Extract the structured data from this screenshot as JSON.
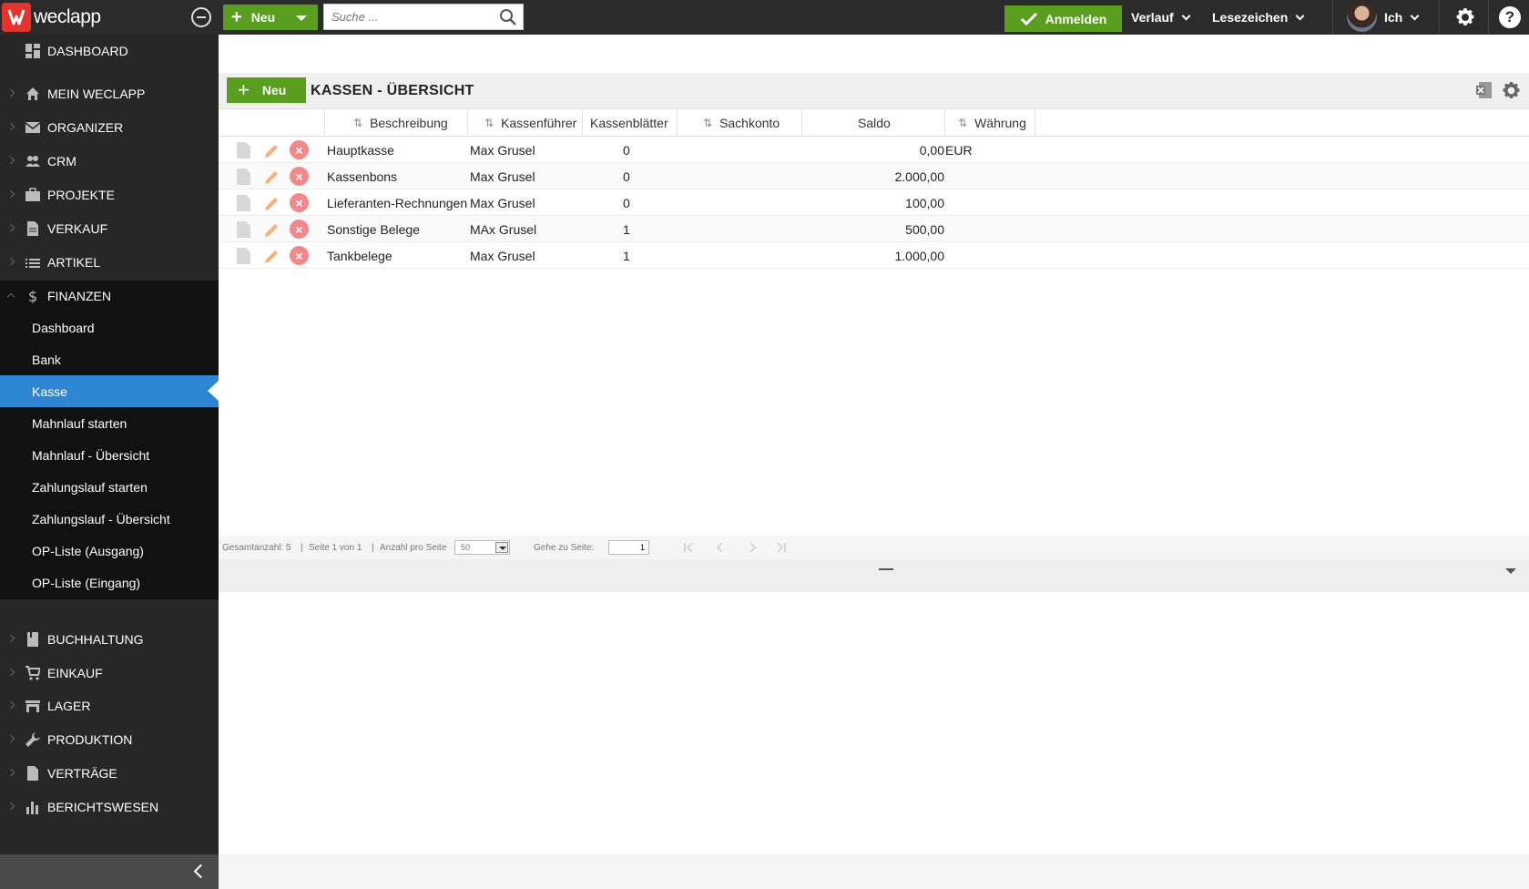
{
  "app": {
    "logo_text": "weclapp"
  },
  "topbar": {
    "new_label": "Neu",
    "search_placeholder": "Suche ...",
    "anmelden_label": "Anmelden",
    "verlauf_label": "Verlauf",
    "lesezeichen_label": "Lesezeichen",
    "user_label": "Ich",
    "help_label": "?"
  },
  "sidebar": {
    "items": [
      {
        "label": "DASHBOARD",
        "icon": "dashboard-icon"
      },
      {
        "label": "MEIN WECLAPP",
        "icon": "home-icon"
      },
      {
        "label": "ORGANIZER",
        "icon": "mail-icon"
      },
      {
        "label": "CRM",
        "icon": "people-icon"
      },
      {
        "label": "PROJEKTE",
        "icon": "briefcase-icon"
      },
      {
        "label": "VERKAUF",
        "icon": "document-icon"
      },
      {
        "label": "ARTIKEL",
        "icon": "list-icon"
      },
      {
        "label": "FINANZEN",
        "icon": "dollar-icon"
      }
    ],
    "finanzen_sub": [
      "Dashboard",
      "Bank",
      "Kasse",
      "Mahnlauf starten",
      "Mahnlauf - Übersicht",
      "Zahlungslauf starten",
      "Zahlungslauf - Übersicht",
      "OP-Liste (Ausgang)",
      "OP-Liste (Eingang)"
    ],
    "lower_items": [
      {
        "label": "BUCHHALTUNG",
        "icon": "book-icon"
      },
      {
        "label": "EINKAUF",
        "icon": "cart-icon"
      },
      {
        "label": "LAGER",
        "icon": "warehouse-icon"
      },
      {
        "label": "PRODUKTION",
        "icon": "wrench-icon"
      },
      {
        "label": "VERTRÄGE",
        "icon": "contract-icon"
      },
      {
        "label": "BERICHTSWESEN",
        "icon": "bar-chart-icon"
      }
    ],
    "active_sub": "Kasse"
  },
  "page": {
    "new_label": "Neu",
    "title": "KASSEN - ÜBERSICHT"
  },
  "table": {
    "columns": [
      "Beschreibung",
      "Kassenführer",
      "Kassenblätter",
      "Sachkonto",
      "Saldo",
      "Währung"
    ],
    "rows": [
      {
        "beschreibung": "Hauptkasse",
        "kassenfuehrer": "Max Grusel",
        "kassenblaetter": "0",
        "sachkonto": "",
        "saldo": "0,00",
        "waehrung": "EUR"
      },
      {
        "beschreibung": "Kassenbons",
        "kassenfuehrer": "Max Grusel",
        "kassenblaetter": "0",
        "sachkonto": "",
        "saldo": "2.000,00",
        "waehrung": ""
      },
      {
        "beschreibung": "Lieferanten-Rechnungen",
        "kassenfuehrer": "Max Grusel",
        "kassenblaetter": "0",
        "sachkonto": "",
        "saldo": "100,00",
        "waehrung": ""
      },
      {
        "beschreibung": "Sonstige Belege",
        "kassenfuehrer": "MAx Grusel",
        "kassenblaetter": "1",
        "sachkonto": "",
        "saldo": "500,00",
        "waehrung": ""
      },
      {
        "beschreibung": "Tankbelege",
        "kassenfuehrer": "Max Grusel",
        "kassenblaetter": "1",
        "sachkonto": "",
        "saldo": "1.000,00",
        "waehrung": ""
      }
    ]
  },
  "pager": {
    "total": "Gesamtanzahl: 5",
    "page_info": "Seite 1 von 1",
    "per_page_label": "Anzahl pro Seite",
    "per_page_value": "50",
    "goto_label": "Gehe zu Seite:",
    "goto_value": "1",
    "separator": "|"
  },
  "colors": {
    "accent_green": "#5a9e1f",
    "active_blue": "#2e86d3",
    "sidebar_bg": "#272727",
    "delete_red": "#f08a8a"
  }
}
